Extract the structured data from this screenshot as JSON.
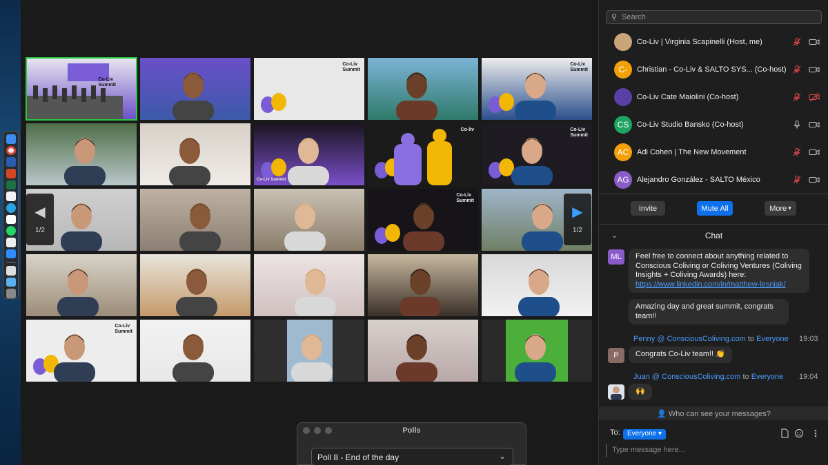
{
  "gallery": {
    "tiles": [
      {
        "label": "Co-Liv\nSummit",
        "kind": "stage"
      },
      {
        "label": "",
        "kind": "group"
      },
      {
        "label": "Co-Liv\nSummit",
        "kind": "logo-light"
      },
      {
        "label": "",
        "kind": "beach"
      },
      {
        "label": "Co-Liv\nSummit",
        "kind": "person-light"
      },
      {
        "label": "",
        "kind": "person-garden"
      },
      {
        "label": "",
        "kind": "person-room"
      },
      {
        "label": "Co-Liv Summit",
        "kind": "purple-slide"
      },
      {
        "label": "Co-liv",
        "kind": "illustration-dark"
      },
      {
        "label": "Co-Liv\nSummit",
        "kind": "person-dark"
      },
      {
        "label": "",
        "kind": "person-bald"
      },
      {
        "label": "",
        "kind": "person-wave"
      },
      {
        "label": "",
        "kind": "person-headphones"
      },
      {
        "label": "Co-Liv\nSummit",
        "kind": "person-dark2"
      },
      {
        "label": "",
        "kind": "person-mountain"
      },
      {
        "label": "",
        "kind": "person-older"
      },
      {
        "label": "",
        "kind": "person-couch"
      },
      {
        "label": "",
        "kind": "person-curly"
      },
      {
        "label": "",
        "kind": "person-shelf"
      },
      {
        "label": "",
        "kind": "person-room2"
      },
      {
        "label": "Co-Liv\nSummit",
        "kind": "person-logo"
      },
      {
        "label": "",
        "kind": "person-woman"
      },
      {
        "label": "",
        "kind": "person-small"
      },
      {
        "label": "",
        "kind": "person-long-hair"
      },
      {
        "label": "",
        "kind": "person-green"
      }
    ],
    "prev_page": {
      "arrow": "◀",
      "label": "1/2"
    },
    "next_page": {
      "arrow": "▶",
      "label": "1/2"
    }
  },
  "polls": {
    "title": "Polls",
    "selected": "Poll 8 - End of the day"
  },
  "panel": {
    "search_placeholder": "Search",
    "participants": [
      {
        "name": "Co-Liv | Virginia Scapinelli (Host, me)",
        "initials": "",
        "color": "#c9a57a",
        "mic_muted": true,
        "cam_off": false
      },
      {
        "name": "Christian - Co-Liv & SALTO SYS...  (Co-host)",
        "initials": "C-",
        "color": "#f2a007",
        "mic_muted": true,
        "cam_off": false
      },
      {
        "name": "Co-Liv Cate Maiolini (Co-host)",
        "initials": "",
        "color": "#5b3fa6",
        "mic_muted": true,
        "cam_off": true
      },
      {
        "name": "Co-Liv Studio Bansko (Co-host)",
        "initials": "CS",
        "color": "#1fa462",
        "mic_muted": false,
        "cam_off": false
      },
      {
        "name": "Adi Cohen | The New Movement",
        "initials": "AC",
        "color": "#f2a007",
        "mic_muted": true,
        "cam_off": false
      },
      {
        "name": "Alejandro González - SALTO México",
        "initials": "AG",
        "color": "#8a5cc9",
        "mic_muted": true,
        "cam_off": false
      }
    ],
    "buttons": {
      "invite": "Invite",
      "mute_all": "Mute All",
      "more": "More"
    },
    "chat": {
      "title": "Chat",
      "messages": [
        {
          "avatar": "ML",
          "avatar_color": "#8a5cc9",
          "text": "Feel free to connect about anything related to Conscious Coliving or Coliving Ventures (Coliving Insights + Coliving Awards) here:",
          "link": "https://www.linkedin.com/in/matthew-lesniak/"
        },
        {
          "text": "Amazing day and great summit, congrats team!!"
        },
        {
          "sender": "Penny @ ConsciousColiving.com",
          "to_word": "to",
          "to": "Everyone",
          "time": "19:03",
          "avatar": "P",
          "avatar_color": "#8a6a64",
          "text": "Congrats Co-Liv team!! 👏"
        },
        {
          "sender": "Juan @ ConsciousColiving.com",
          "to_word": "to",
          "to": "Everyone",
          "time": "19:04",
          "avatar": "",
          "avatar_color": "#5a6a7a",
          "text": "🙌"
        }
      ],
      "who_can_see": "Who can see your messages?",
      "to_label": "To:",
      "to_value": "Everyone",
      "input_placeholder": "Type message here..."
    }
  },
  "colors": {
    "accent": "#0e71eb",
    "active_speaker": "#27c93f",
    "panel_bg": "#1e1e1e"
  }
}
